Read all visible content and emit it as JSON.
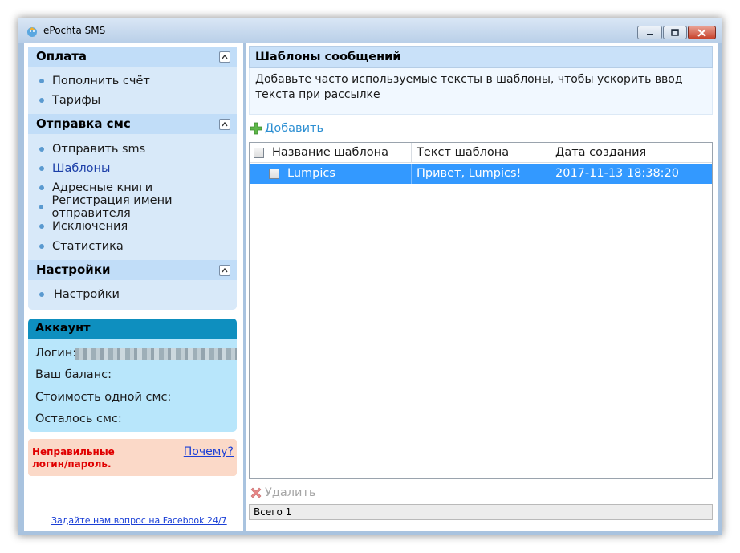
{
  "window": {
    "title": "ePochta SMS",
    "icon": "epochta-bird-icon",
    "controls": [
      "minimize",
      "maximize",
      "close"
    ]
  },
  "sidebar": {
    "sections": [
      {
        "title": "Оплата",
        "items": [
          {
            "label": "Пополнить счёт"
          },
          {
            "label": "Тарифы"
          }
        ]
      },
      {
        "title": "Отправка смс",
        "items": [
          {
            "label": "Отправить sms"
          },
          {
            "label": "Шаблоны",
            "active": true
          },
          {
            "label": "Адресные книги"
          },
          {
            "label": "Регистрация имени отправителя"
          },
          {
            "label": "Исключения"
          },
          {
            "label": "Статистика"
          }
        ]
      },
      {
        "title": "Настройки",
        "items": [
          {
            "label": "Настройки"
          }
        ]
      }
    ],
    "account": {
      "title": "Аккаунт",
      "login_label": "Логин:",
      "balance_label": "Ваш баланс:",
      "sms_cost_label": "Стоимость одной смс:",
      "sms_left_label": "Осталось смс:"
    },
    "error": {
      "message": "Неправильные логин/пароль.",
      "why_link": "Почему?"
    },
    "facebook_link": "Задайте нам вопрос на Facebook 24/7"
  },
  "main": {
    "title": "Шаблоны сообщений",
    "description": "Добавьте часто используемые тексты в шаблоны, чтобы ускорить ввод текста при рассылке",
    "add_label": "Добавить",
    "delete_label": "Удалить",
    "table": {
      "columns": [
        "Название шаблона",
        "Текст шаблона",
        "Дата создания"
      ],
      "rows": [
        {
          "name": "Lumpics",
          "text": "Привет, Lumpics!",
          "date": "2017-11-13 18:38:20",
          "selected": true
        }
      ]
    },
    "status": "Всего 1"
  },
  "colors": {
    "selection": "#3399ff",
    "section_header": "#c1ddf8",
    "account_header": "#0e8fbf",
    "error_text": "#e00000",
    "link": "#1a3fd6"
  }
}
